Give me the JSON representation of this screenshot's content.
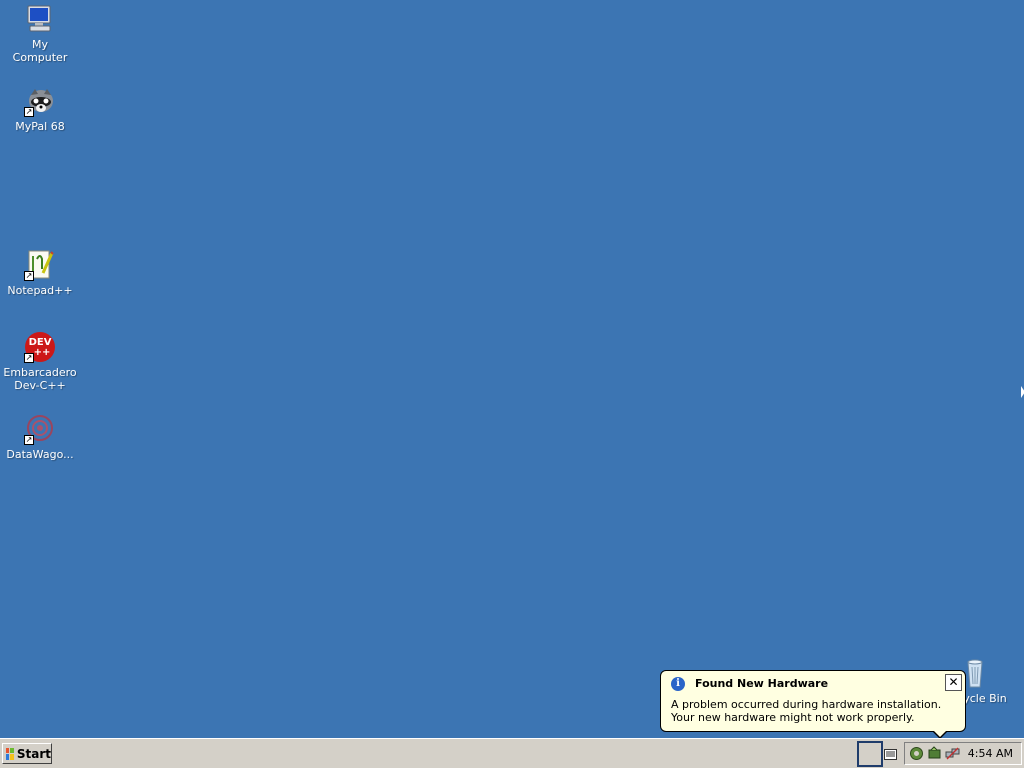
{
  "desktop": {
    "background": "#3c75b3",
    "icons": [
      {
        "label": "My Computer",
        "icon": "my-computer-icon"
      },
      {
        "label": "MyPal 68",
        "icon": "mypal-raccoon-icon",
        "shortcut": true
      },
      {
        "label": "Notepad++",
        "icon": "notepad-plus-plus-icon",
        "shortcut": true
      },
      {
        "label": "Embarcadero Dev-C++",
        "icon": "devcpp-icon",
        "shortcut": true
      },
      {
        "label": "DataWago...",
        "icon": "datawagon-icon",
        "shortcut": true
      },
      {
        "label": "Recycle Bin",
        "icon": "recycle-bin-icon"
      }
    ],
    "devcpp_glyph_text": "DEV\n++"
  },
  "balloon": {
    "title": "Found New Hardware",
    "body": "A problem occurred during hardware installation. Your new hardware might not work properly.",
    "close_label": "✕",
    "info_glyph": "i"
  },
  "taskbar": {
    "start_label": "Start",
    "clock": "4:54 AM"
  }
}
